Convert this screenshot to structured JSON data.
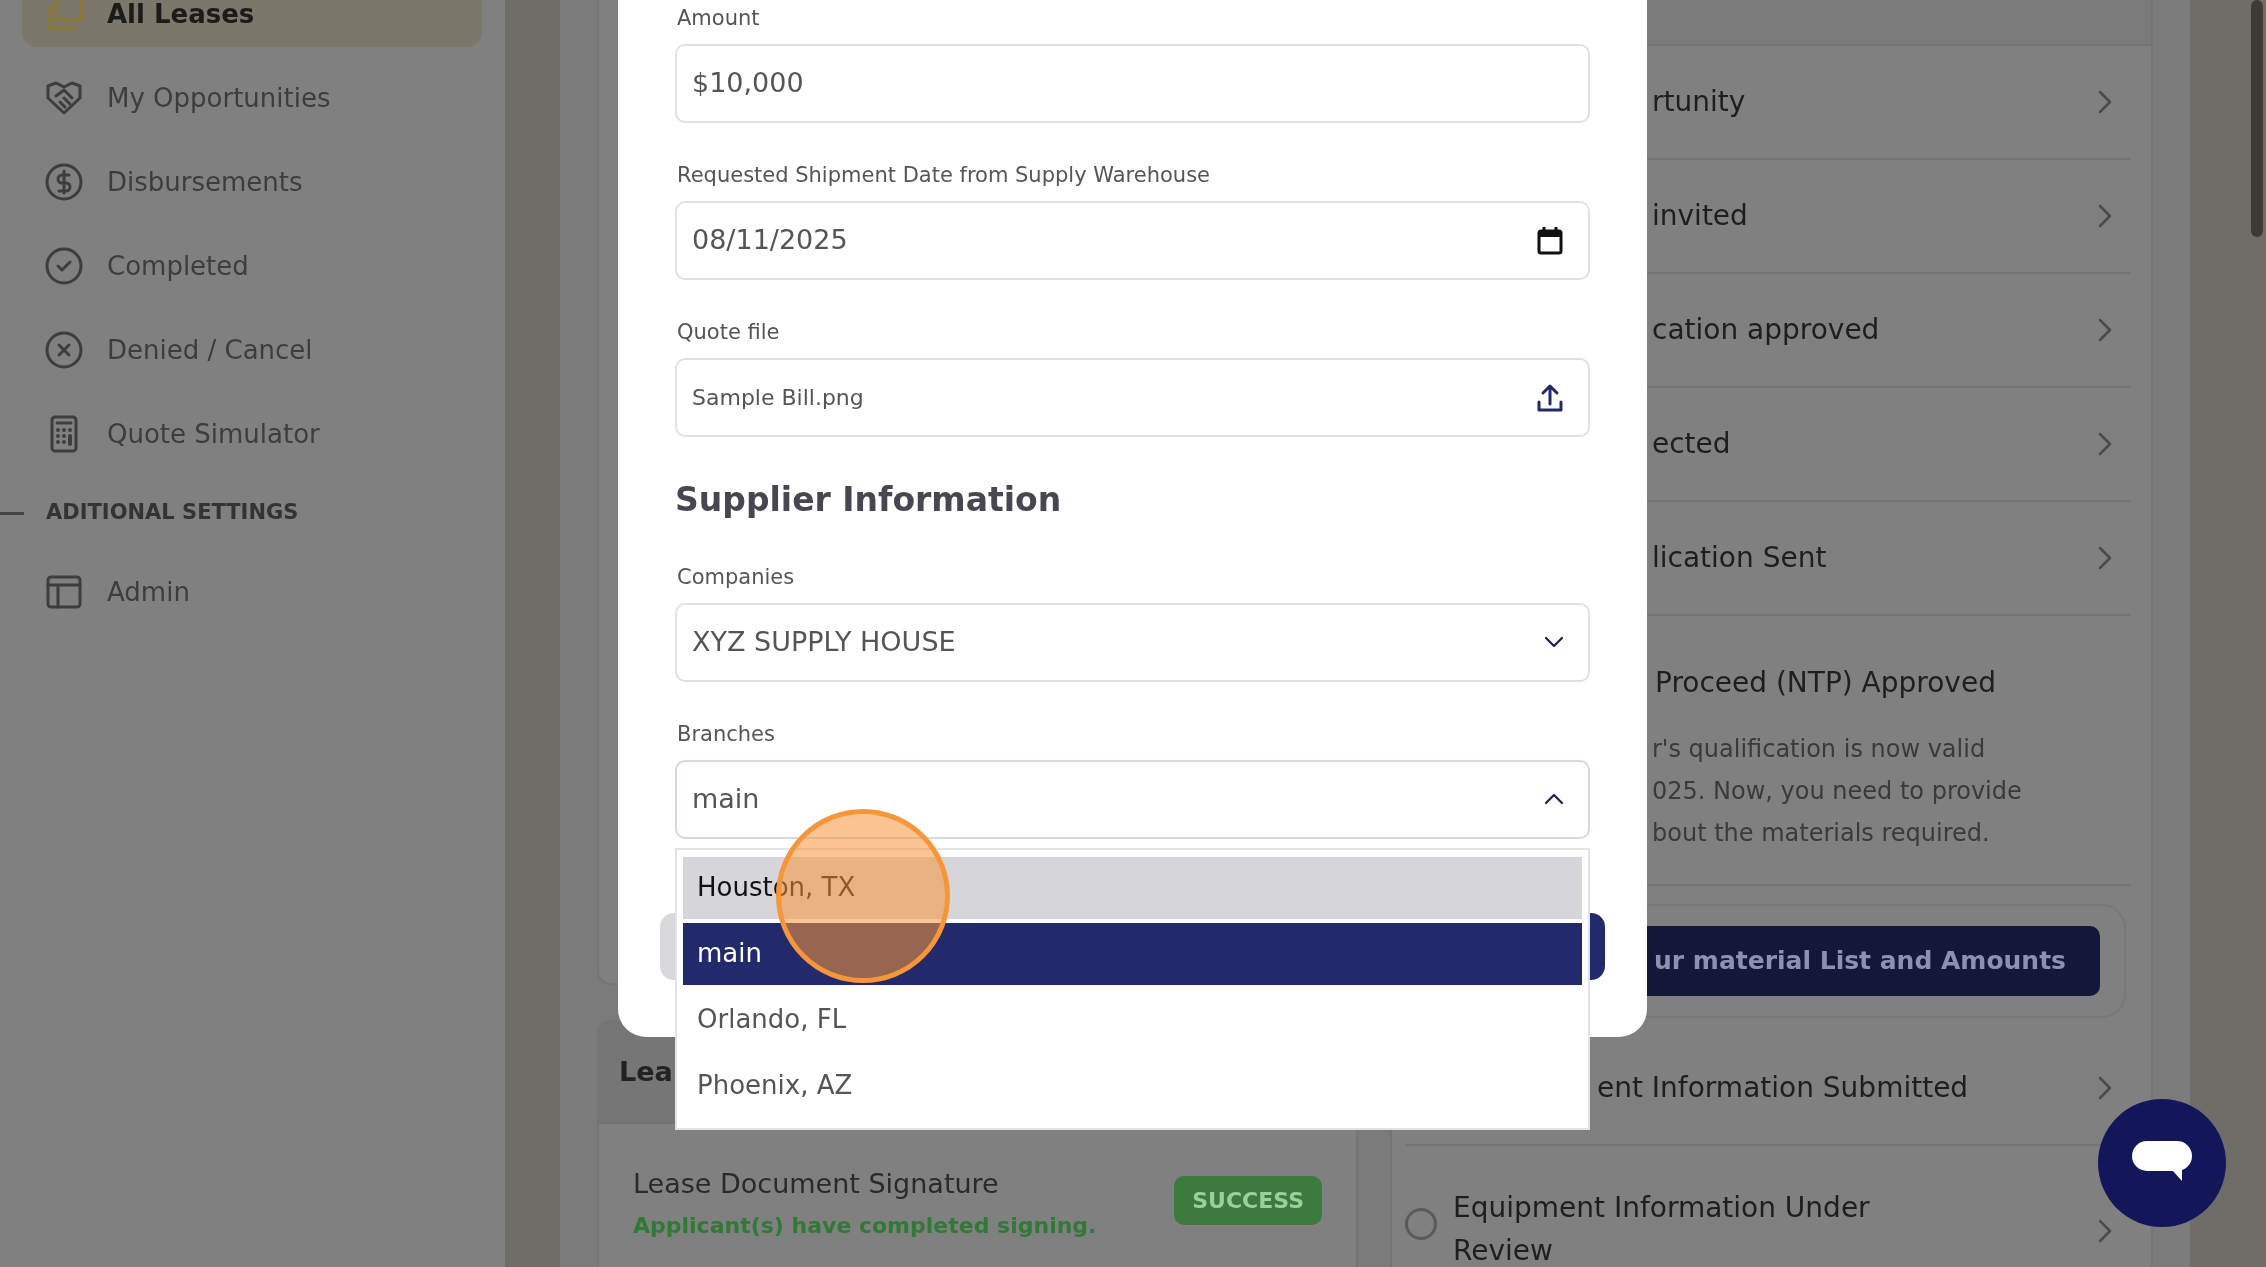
{
  "sidebar": {
    "items": [
      {
        "label": "All Leases",
        "selected": true
      },
      {
        "label": "My Opportunities",
        "selected": false
      },
      {
        "label": "Disbursements",
        "selected": false
      },
      {
        "label": "Completed",
        "selected": false
      },
      {
        "label": "Denied / Cancel",
        "selected": false
      },
      {
        "label": "Quote Simulator",
        "selected": false
      }
    ],
    "section_heading": "ADITIONAL SETTINGS",
    "section_items": [
      {
        "label": "Admin",
        "selected": false
      }
    ]
  },
  "left_panel": {
    "header": "Lea",
    "items": [
      {
        "title": "Lease Document Signature",
        "subtitle": "Applicant(s) have completed signing.",
        "status": "SUCCESS"
      }
    ]
  },
  "right_panel": {
    "steps": [
      {
        "title": "rtunity",
        "expanded": false
      },
      {
        "title": "invited",
        "expanded": false
      },
      {
        "title": "cation approved",
        "expanded": false
      },
      {
        "title": "ected",
        "expanded": false
      },
      {
        "title": "lication Sent",
        "expanded": false
      },
      {
        "title": "Proceed (NTP) Approved",
        "expanded": true,
        "description": [
          "r's qualification is now valid",
          "025. Now, you need to provide",
          "bout the materials required."
        ],
        "action": "ur material List and Amounts"
      },
      {
        "title": "ent Information Submitted",
        "expanded": false
      },
      {
        "title": "Equipment Information Under Review",
        "expanded": false,
        "checked": false
      }
    ]
  },
  "modal": {
    "fields": [
      {
        "kind": "text",
        "label": "Amount",
        "value": "$10,000"
      },
      {
        "kind": "date",
        "label": "Requested Shipment Date from Supply Warehouse",
        "value": "08/11/2025"
      },
      {
        "kind": "file",
        "label": "Quote file",
        "value": "Sample Bill.png"
      }
    ],
    "section_title": "Supplier Information",
    "selects": [
      {
        "label": "Companies",
        "value": "XYZ SUPPLY HOUSE",
        "expanded": false
      },
      {
        "label": "Branches",
        "value": "main",
        "expanded": true,
        "options": [
          {
            "label": "Houston, TX",
            "hovered": true,
            "selected": false
          },
          {
            "label": "main",
            "hovered": false,
            "selected": true
          },
          {
            "label": "Orlando, FL",
            "hovered": false,
            "selected": false
          },
          {
            "label": "Phoenix, AZ",
            "hovered": false,
            "selected": false
          }
        ]
      }
    ]
  }
}
